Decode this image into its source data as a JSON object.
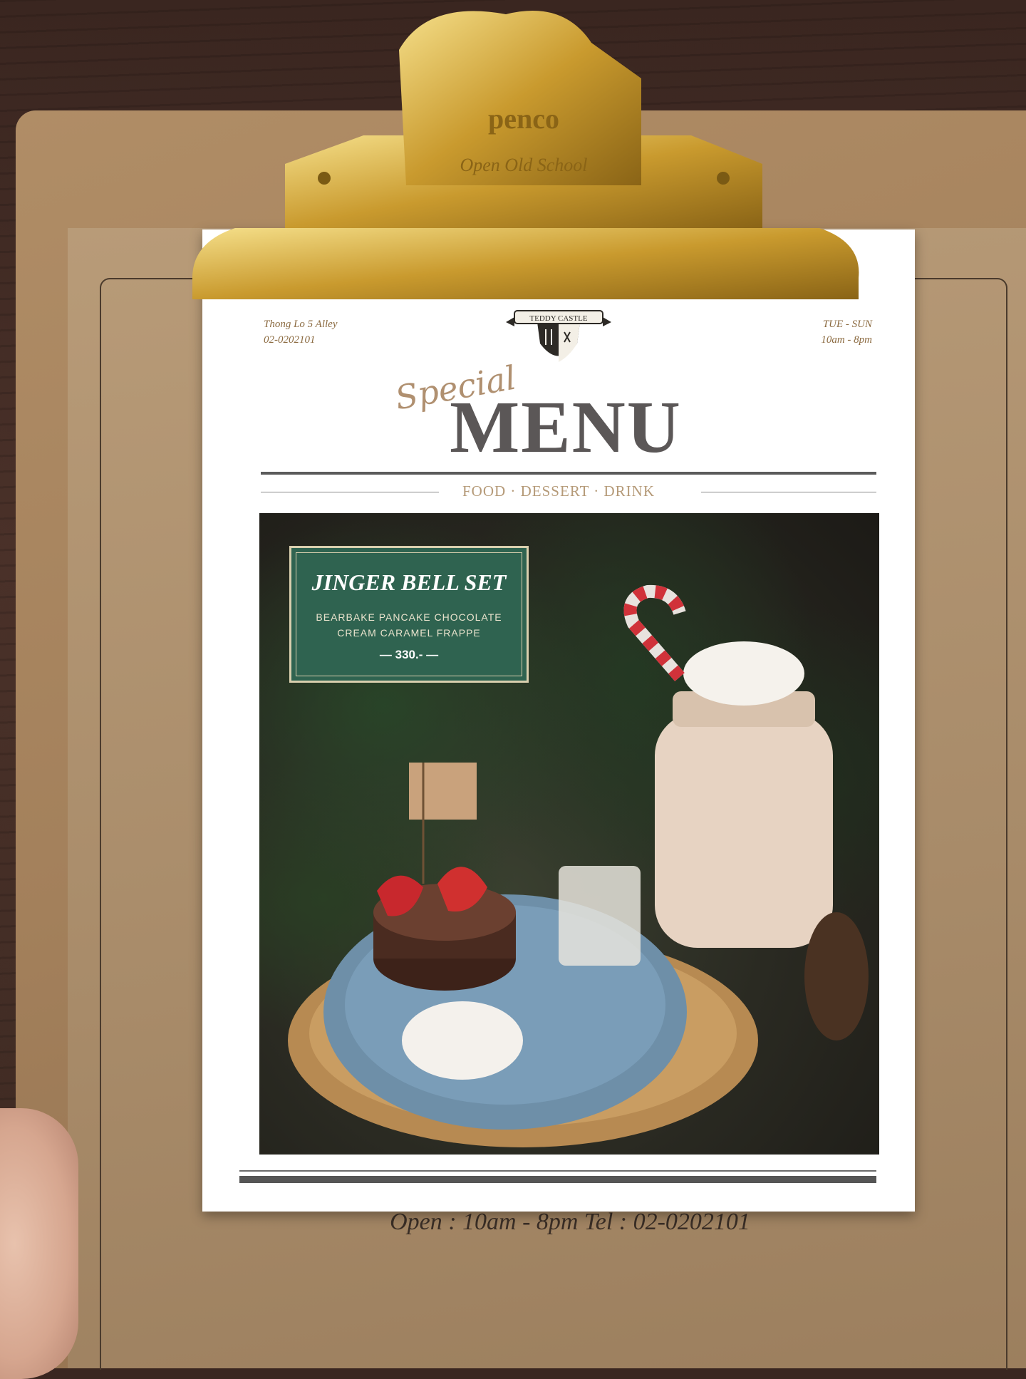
{
  "clipboard": {
    "brand": "penco",
    "slogan": "Open Old School",
    "footer": "Open : 10am - 8pm Tel : 02-0202101"
  },
  "menu": {
    "address": "Thong Lo 5 Alley",
    "phone": "02-0202101",
    "days": "TUE - SUN",
    "hours": "10am - 8pm",
    "logo_text": "TEDDY CASTLE",
    "script_title": "Special",
    "title": "MENU",
    "subnav": "FOOD · DESSERT · DRINK"
  },
  "promo": {
    "name": "JINGER BELL SET",
    "desc_line1": "BEARBAKE PANCAKE CHOCOLATE",
    "desc_line2": "CREAM CARAMEL FRAPPE",
    "price": "330.-"
  }
}
